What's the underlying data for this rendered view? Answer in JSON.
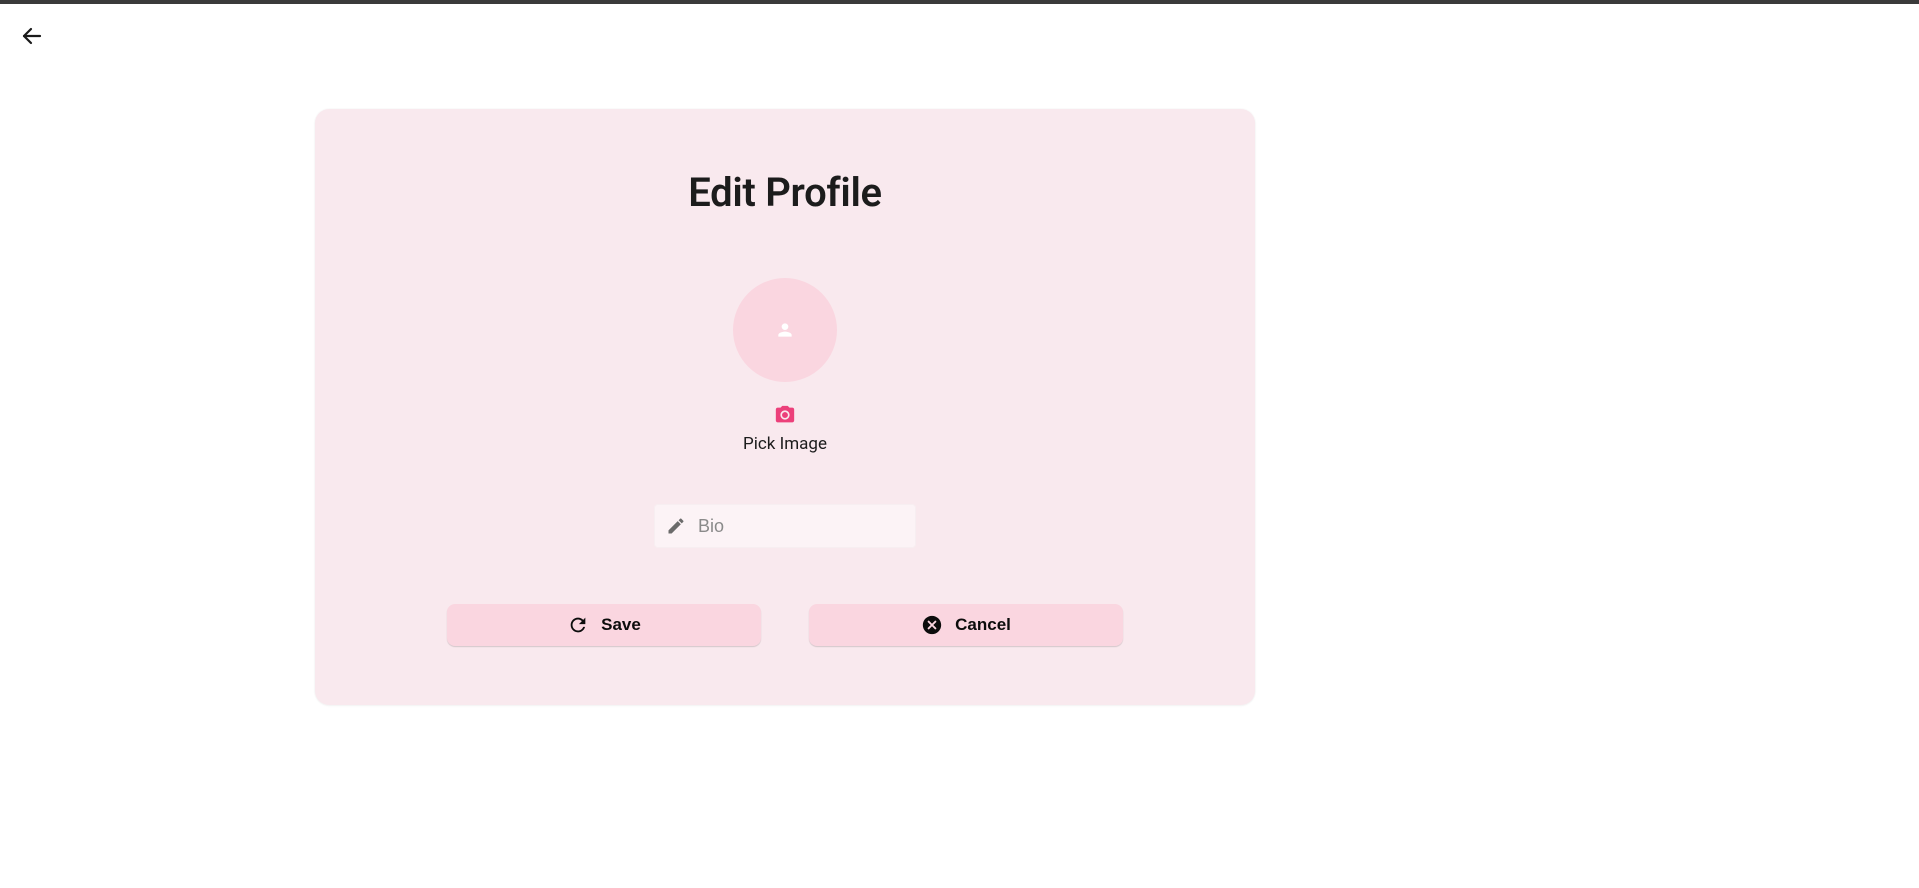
{
  "page": {
    "title": "Edit Profile"
  },
  "pick_image": {
    "label": "Pick Image"
  },
  "bio": {
    "placeholder": "Bio",
    "value": ""
  },
  "buttons": {
    "save": "Save",
    "cancel": "Cancel"
  },
  "colors": {
    "card_bg": "#f9e9ee",
    "avatar_bg": "#fad6e0",
    "button_bg": "#fad6e0",
    "accent_pink": "#ec407a"
  }
}
